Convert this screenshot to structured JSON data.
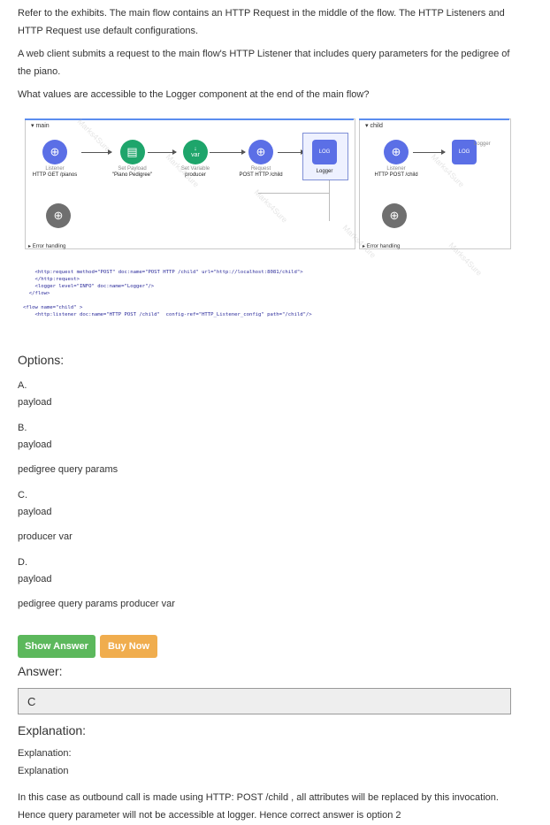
{
  "question": {
    "para1": "Refer to the exhibits. The main flow contains an HTTP Request in the middle of the flow. The HTTP Listeners and HTTP Request use default configurations.",
    "para2": "A web client submits a request to the main flow's HTTP Listener that includes query parameters for the pedigree of the piano.",
    "para3": "What values are accessible to the Logger component at the end of the main flow?"
  },
  "exhibit": {
    "main_flow_title": "main",
    "child_flow_title": "child",
    "main_nodes": [
      {
        "sub": "Listener",
        "label": "HTTP GET /pianos"
      },
      {
        "sub": "Set Payload",
        "label": "\"Piano Pedigree\""
      },
      {
        "sub": "Set Variable",
        "label": "producer"
      },
      {
        "sub": "Request",
        "label": "POST HTTP /child"
      },
      {
        "sub": "",
        "label": "Logger"
      }
    ],
    "child_nodes": [
      {
        "sub": "Listener",
        "label": "HTTP POST /child"
      },
      {
        "sub": "",
        "label": "Logger"
      }
    ],
    "error_handling": "Error handling",
    "var_text": "var",
    "log_text": "LOG",
    "code_lines": [
      "    <http:request method=\"POST\" doc:name=\"POST HTTP /child\" url=\"http://localhost:8081/child\">",
      "    </http:request>",
      "    <logger level=\"INFO\" doc:name=\"Logger\"/>",
      "  </flow>",
      "",
      "<flow name=\"child\" >",
      "    <http:listener doc:name=\"HTTP POST /child\"  config-ref=\"HTTP_Listener_config\" path=\"/child\"/>"
    ],
    "watermark": "Marks4Sure"
  },
  "options": {
    "title": "Options:",
    "items": [
      {
        "letter": "A.",
        "lines": [
          "payload"
        ]
      },
      {
        "letter": "B.",
        "lines": [
          "payload",
          "pedigree query params"
        ]
      },
      {
        "letter": "C.",
        "lines": [
          "payload",
          "producer var"
        ]
      },
      {
        "letter": "D.",
        "lines": [
          "payload",
          "pedigree query params producer var"
        ]
      }
    ]
  },
  "buttons": {
    "show_answer": "Show Answer",
    "buy_now": "Buy Now"
  },
  "answer": {
    "title": "Answer:",
    "value": "C"
  },
  "explanation": {
    "title": "Explanation:",
    "line1": "Explanation:",
    "line2": "Explanation",
    "para": "In this case as outbound call is made using HTTP: POST /child , all attributes will be replaced by this invocation. Hence query parameter will not be accessible at logger. Hence correct answer is option 2"
  },
  "colors": {
    "show_answer_bg": "#5cb85c",
    "buy_now_bg": "#f0ad4e",
    "mule_blue": "#5b6fe6",
    "mule_green": "#1ea56b"
  }
}
